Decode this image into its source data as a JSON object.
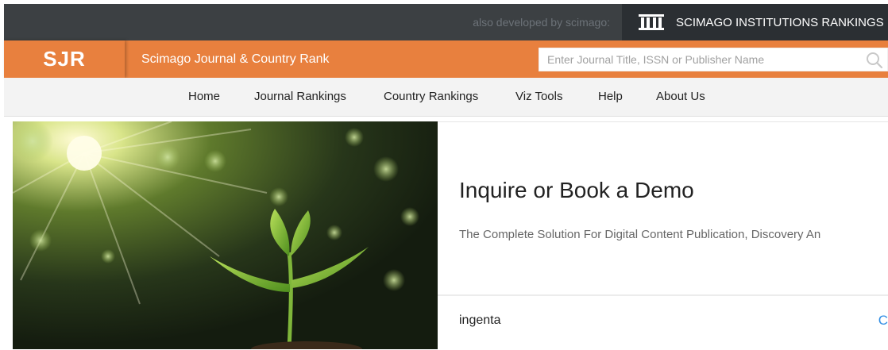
{
  "topbar": {
    "also_developed": "also developed by scimago:",
    "sir_label": "SCIMAGO INSTITUTIONS RANKINGS",
    "sir_icon": "institution-columns-icon"
  },
  "header": {
    "logo": "SJR",
    "brand": "Scimago Journal & Country Rank",
    "search_placeholder": "Enter Journal Title, ISSN or Publisher Name",
    "search_icon": "search-icon"
  },
  "nav": {
    "items": [
      {
        "label": "Home"
      },
      {
        "label": "Journal Rankings"
      },
      {
        "label": "Country Rankings"
      },
      {
        "label": "Viz Tools"
      },
      {
        "label": "Help"
      },
      {
        "label": "About Us"
      }
    ]
  },
  "ad": {
    "title": "Inquire or Book a Demo",
    "description": "The Complete Solution For Digital Content Publication, Discovery An",
    "advertiser": "ingenta",
    "more_glyph": "C"
  },
  "colors": {
    "orange": "#e8803e",
    "topbar": "#3c4043",
    "sir_bg": "#2b2f33",
    "link_blue": "#2f8de4"
  }
}
